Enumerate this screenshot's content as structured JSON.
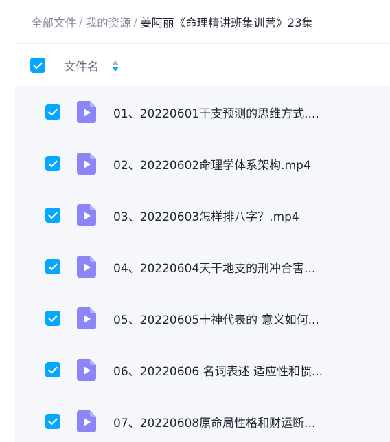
{
  "breadcrumb": [
    {
      "label": "全部文件",
      "current": false
    },
    {
      "label": "我的资源",
      "current": false
    },
    {
      "label": "姜阿丽《命理精讲班集训营》23集",
      "current": true
    }
  ],
  "breadcrumb_separator": "/",
  "header": {
    "name_label": "文件名",
    "select_all_checked": true
  },
  "files": [
    {
      "name": "01、20220601干支预测的思维方式....",
      "checked": true
    },
    {
      "name": "02、20220602命理学体系架构.mp4",
      "checked": true
    },
    {
      "name": "03、20220603怎样排八字？.mp4",
      "checked": true
    },
    {
      "name": "04、20220604天干地支的刑冲合害...",
      "checked": true
    },
    {
      "name": "05、20220605十神代表的 意义如何...",
      "checked": true
    },
    {
      "name": "06、20220606 名词表述 适应性和惯...",
      "checked": true
    },
    {
      "name": "07、20220608原命局性格和财运断...",
      "checked": true
    }
  ],
  "icons": {
    "checkbox": "checkbox-checked-icon",
    "file": "video-file-icon",
    "sort": "sort-icon"
  },
  "colors": {
    "accent": "#06a7ff",
    "file_icon": "#8b85f8",
    "list_background": "#f6f7fb"
  }
}
